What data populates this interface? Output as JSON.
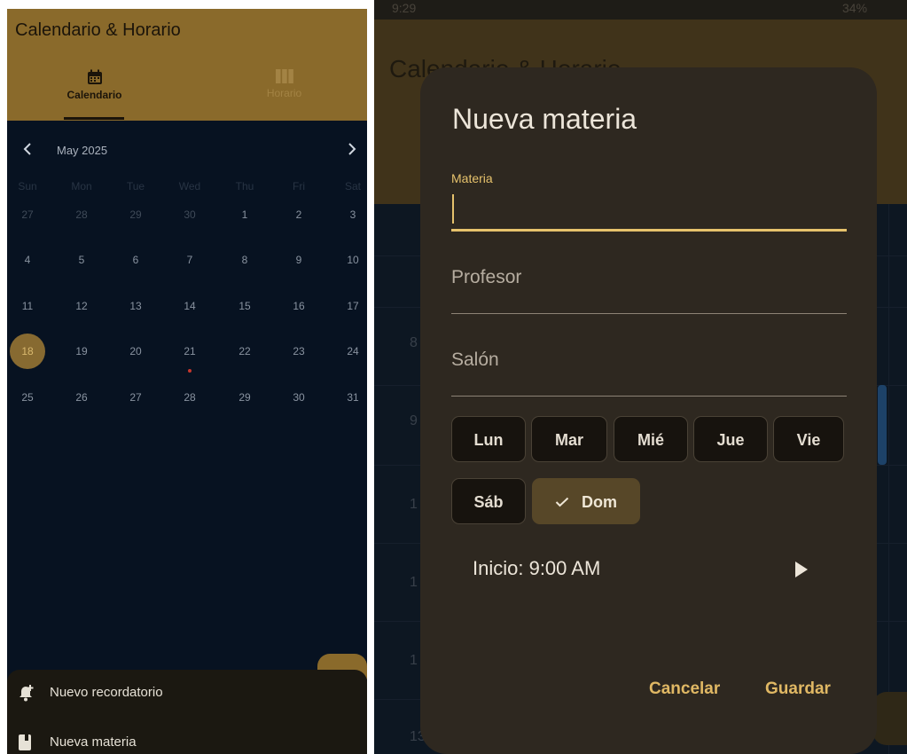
{
  "left_screen": {
    "app_title": "Calendario & Horario",
    "tabs": [
      {
        "label": "Calendario",
        "icon": "calendar-icon",
        "active": true
      },
      {
        "label": "Horario",
        "icon": "columns-icon",
        "active": false
      }
    ],
    "calendar": {
      "month_label": "May 2025",
      "weekdays": [
        "Sun",
        "Mon",
        "Tue",
        "Wed",
        "Thu",
        "Fri",
        "Sat"
      ],
      "weeks": [
        [
          "27",
          "28",
          "29",
          "30",
          "1",
          "2",
          "3"
        ],
        [
          "4",
          "5",
          "6",
          "7",
          "8",
          "9",
          "10"
        ],
        [
          "11",
          "12",
          "13",
          "14",
          "15",
          "16",
          "17"
        ],
        [
          "18",
          "19",
          "20",
          "21",
          "22",
          "23",
          "24"
        ],
        [
          "25",
          "26",
          "27",
          "28",
          "29",
          "30",
          "31"
        ]
      ],
      "today": "18",
      "event_day": "21"
    },
    "bottom_sheet": [
      {
        "label": "Nuevo recordatorio",
        "icon": "add-alert-icon"
      },
      {
        "label": "Nueva materia",
        "icon": "book-icon"
      }
    ]
  },
  "right_screen": {
    "status_time": "9:29",
    "battery": "34%",
    "background_title": "Calendario & Horario",
    "background_times": [
      "8",
      "9",
      "1",
      "1",
      "1",
      "13"
    ],
    "dialog": {
      "title": "Nueva materia",
      "materia_label": "Materia",
      "profesor_placeholder": "Profesor",
      "salon_placeholder": "Salón",
      "days": [
        "Lun",
        "Mar",
        "Mié",
        "Jue",
        "Vie",
        "Sáb",
        "Dom"
      ],
      "selected_day": "Dom",
      "start_label": "Inicio: 9:00 AM",
      "cancel_label": "Cancelar",
      "save_label": "Guardar"
    }
  },
  "colors": {
    "accent_gold": "#8a6a2b",
    "dialog_bg": "#2e2820",
    "action_text": "#e0b864",
    "calendar_bg": "#071221"
  }
}
